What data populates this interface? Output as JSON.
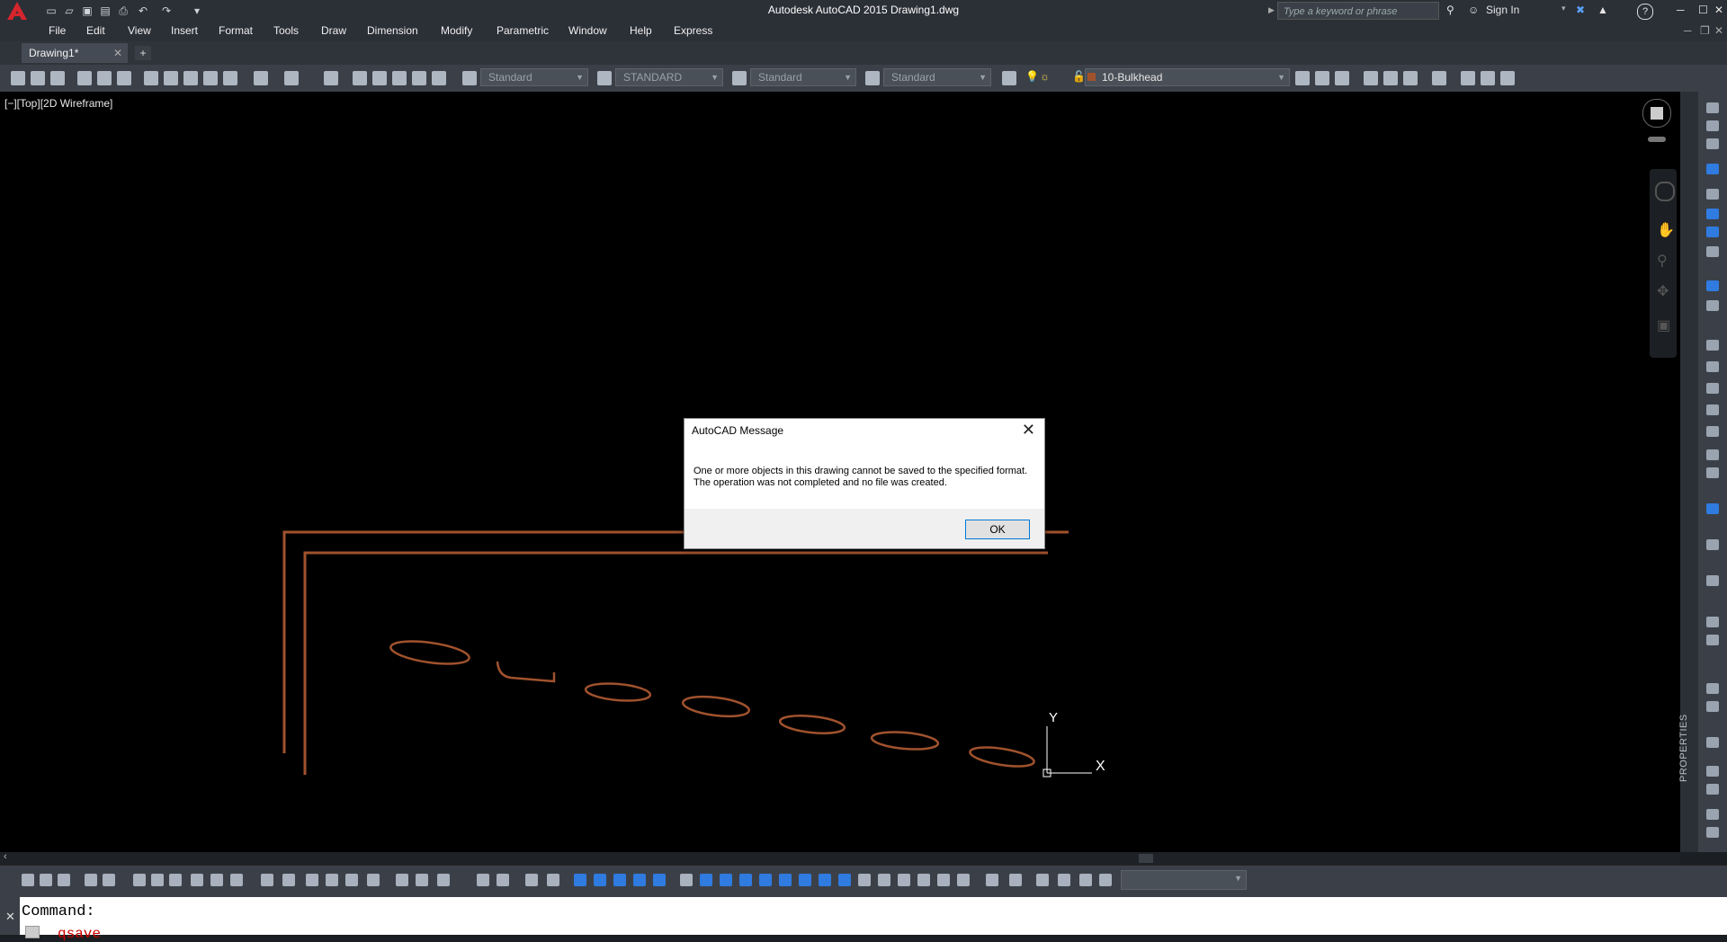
{
  "window": {
    "title": "Autodesk AutoCAD 2015    Drawing1.dwg",
    "search_placeholder": "Type a keyword or phrase",
    "sign_in_label": "Sign In",
    "help_label": "?"
  },
  "menubar": {
    "items": [
      "File",
      "Edit",
      "View",
      "Insert",
      "Format",
      "Tools",
      "Draw",
      "Dimension",
      "Modify",
      "Parametric",
      "Window",
      "Help",
      "Express"
    ]
  },
  "tabs": {
    "active": "Drawing1*",
    "close_label": "✕",
    "new_label": "+"
  },
  "toolbar": {
    "text_style": "Standard",
    "dim_style": "STANDARD",
    "table_style": "Standard",
    "mleader_style": "Standard",
    "layer": "10-Bulkhead",
    "layer_color": "#a0522d"
  },
  "viewport": {
    "label": "[−][Top][2D Wireframe]",
    "ucs_x": "X",
    "ucs_y": "Y",
    "drawing_color": "#a0522d"
  },
  "palette": {
    "properties_label": "PROPERTIES"
  },
  "command": {
    "prompt": "Command:",
    "history": "qsave"
  },
  "dialog": {
    "title": "AutoCAD Message",
    "message": "One or more objects in this drawing cannot be saved to the specified format. The operation was not completed and no file was created.",
    "ok_label": "OK",
    "close_label": "✕"
  }
}
